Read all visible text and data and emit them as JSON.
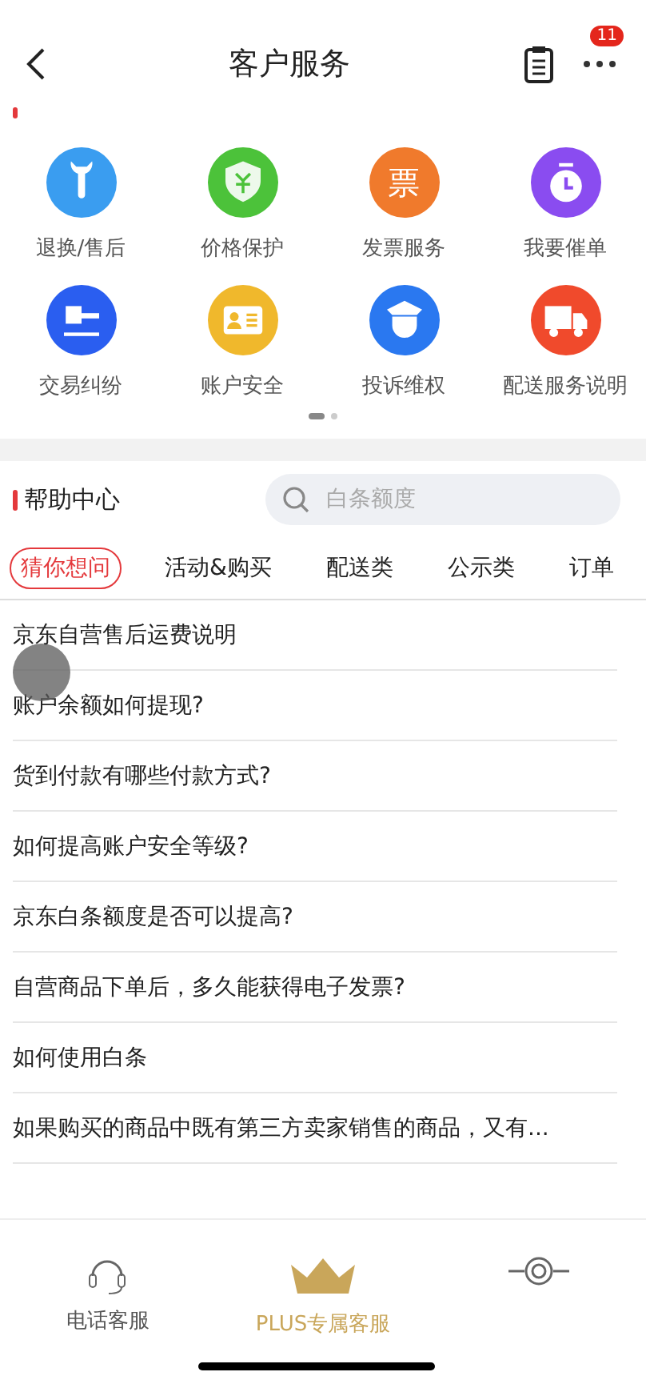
{
  "header": {
    "title": "客户服务",
    "badge": "11"
  },
  "services": [
    {
      "label": "退换/售后",
      "kind": "wrench",
      "color": "#3a9df0"
    },
    {
      "label": "价格保护",
      "kind": "shield",
      "color": "#4cc23a"
    },
    {
      "label": "发票服务",
      "kind": "glyph",
      "color": "#f07a2c",
      "glyph": "票"
    },
    {
      "label": "我要催单",
      "kind": "timer",
      "color": "#8a4cf0"
    },
    {
      "label": "交易纠纷",
      "kind": "gavel",
      "color": "#2a5ef0"
    },
    {
      "label": "账户安全",
      "kind": "card",
      "color": "#f0b82c"
    },
    {
      "label": "投诉维权",
      "kind": "police",
      "color": "#2a78f0"
    },
    {
      "label": "配送服务说明",
      "kind": "truck",
      "color": "#f04a2c"
    }
  ],
  "help": {
    "title": "帮助中心",
    "search": {
      "placeholder": "白条额度"
    }
  },
  "tabs": [
    {
      "label": "猜你想问",
      "selected": true
    },
    {
      "label": "活动&购买",
      "selected": false
    },
    {
      "label": "配送类",
      "selected": false
    },
    {
      "label": "公示类",
      "selected": false
    },
    {
      "label": "订单",
      "selected": false
    }
  ],
  "questions": [
    "京东自营售后运费说明",
    "账户余额如何提现?",
    "货到付款有哪些付款方式?",
    "如何提高账户安全等级?",
    "京东白条额度是否可以提高?",
    "自营商品下单后，多久能获得电子发票?",
    "如何使用白条",
    "如果购买的商品中既有第三方卖家销售的商品，又有..."
  ],
  "bottom_nav": [
    {
      "kind": "phone",
      "label": "电话客服"
    },
    {
      "kind": "plus",
      "label": "PLUS专属客服"
    },
    {
      "kind": "other"
    }
  ]
}
